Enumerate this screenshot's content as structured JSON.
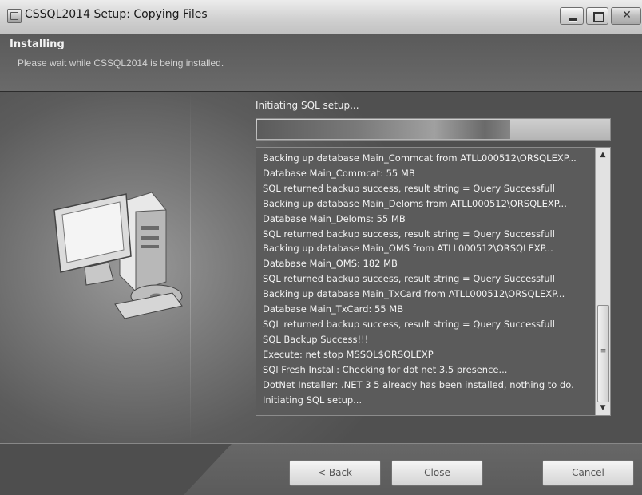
{
  "window": {
    "title": "CSSQL2014 Setup: Copying Files"
  },
  "window_controls": {
    "close_glyph": "✕"
  },
  "header": {
    "title": "Installing",
    "subtitle": "Please wait while CSSQL2014 is being installed."
  },
  "status": {
    "text": "Initiating SQL setup...",
    "progress_fraction": 0.72
  },
  "log": {
    "lines": [
      "Backing up database Main_Commcat from ATLL000512\\ORSQLEXP...",
      "Database Main_Commcat: 55 MB",
      "SQL returned backup success, result string = Query Successfull",
      "Backing up database Main_Deloms from ATLL000512\\ORSQLEXP...",
      "Database Main_Deloms: 55 MB",
      "SQL returned backup success, result string = Query Successfull",
      "Backing up database Main_OMS from ATLL000512\\ORSQLEXP...",
      "Database Main_OMS: 182 MB",
      "SQL returned backup success, result string = Query Successfull",
      "Backing up database Main_TxCard from ATLL000512\\ORSQLEXP...",
      "Database Main_TxCard: 55 MB",
      "SQL returned backup success, result string = Query Successfull",
      "SQL Backup Success!!!",
      "Execute: net stop MSSQL$ORSQLEXP",
      "SQl Fresh Install: Checking for dot net 3.5 presence...",
      "DotNet Installer: .NET 3 5 already has been installed, nothing to do.",
      "Initiating SQL setup..."
    ],
    "scroll_up_glyph": "▲",
    "scroll_down_glyph": "▼",
    "scroll_grip_glyph": "≡"
  },
  "footer": {
    "back_label": "< Back",
    "close_label": "Close",
    "cancel_label": "Cancel"
  }
}
